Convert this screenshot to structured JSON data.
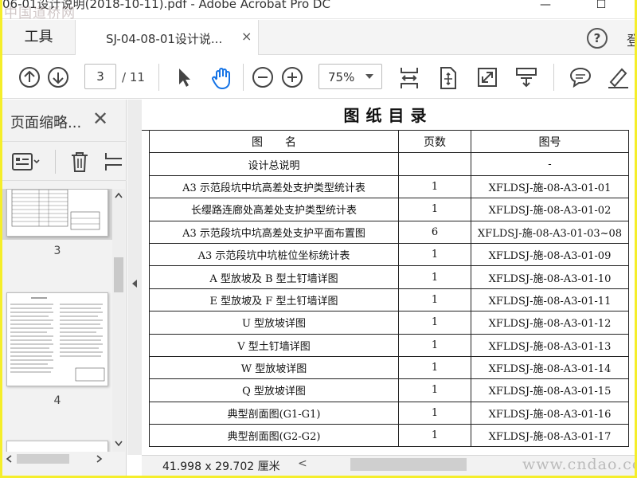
{
  "window": {
    "title": "06-01设计说明(2018-10-11).pdf - Adobe Acrobat Pro DC",
    "watermark_top": "中国道桥网",
    "minimize": "—",
    "maximize": "☐"
  },
  "tabs": {
    "tools": "工具",
    "document": "SJ-04-08-01设计说...",
    "close": "×",
    "help": "?",
    "login": "登"
  },
  "toolbar": {
    "current_page": "3",
    "total_pages": "/ 11",
    "zoom": "75%"
  },
  "left_pane": {
    "title": "页面缩略...",
    "close": "✕",
    "thumbnails": [
      {
        "label": "3",
        "selected": true
      },
      {
        "label": "4",
        "selected": false
      }
    ]
  },
  "document": {
    "title": "图纸目录",
    "columns": [
      "图　　名",
      "页数",
      "图号"
    ],
    "rows": [
      {
        "name": "设计总说明",
        "pages": "",
        "code": "-"
      },
      {
        "name": "A3 示范段坑中坑高差处支护类型统计表",
        "pages": "1",
        "code": "XFLDSJ-施-08-A3-01-01"
      },
      {
        "name": "长缨路连廊处高差处支护类型统计表",
        "pages": "1",
        "code": "XFLDSJ-施-08-A3-01-02"
      },
      {
        "name": "A3 示范段坑中坑高差处支护平面布置图",
        "pages": "6",
        "code": "XFLDSJ-施-08-A3-01-03~08"
      },
      {
        "name": "A3 示范段坑中坑桩位坐标统计表",
        "pages": "1",
        "code": "XFLDSJ-施-08-A3-01-09"
      },
      {
        "name": "A 型放坡及 B 型土钉墙详图",
        "pages": "1",
        "code": "XFLDSJ-施-08-A3-01-10"
      },
      {
        "name": "E 型放坡及 F 型土钉墙详图",
        "pages": "1",
        "code": "XFLDSJ-施-08-A3-01-11"
      },
      {
        "name": "U 型放坡详图",
        "pages": "1",
        "code": "XFLDSJ-施-08-A3-01-12"
      },
      {
        "name": "V 型土钉墙详图",
        "pages": "1",
        "code": "XFLDSJ-施-08-A3-01-13"
      },
      {
        "name": "W 型放坡详图",
        "pages": "1",
        "code": "XFLDSJ-施-08-A3-01-14"
      },
      {
        "name": "Q 型放坡详图",
        "pages": "1",
        "code": "XFLDSJ-施-08-A3-01-15"
      },
      {
        "name": "典型剖面图(G1-G1)",
        "pages": "1",
        "code": "XFLDSJ-施-08-A3-01-16"
      },
      {
        "name": "典型剖面图(G2-G2)",
        "pages": "1",
        "code": "XFLDSJ-施-08-A3-01-17"
      }
    ]
  },
  "status": {
    "page_size": "41.998 x 29.702 厘米",
    "watermark": "www.cndao.com"
  },
  "colors": {
    "frame": "#f5ee2a",
    "accent_blue": "#1473e6"
  },
  "icons": [
    "prev-page-icon",
    "next-page-icon",
    "select-arrow-icon",
    "hand-icon",
    "zoom-out-icon",
    "zoom-in-icon",
    "fit-width-icon",
    "fit-page-icon",
    "fullscreen-icon",
    "scroll-mode-icon",
    "comment-icon",
    "highlight-icon",
    "options-icon",
    "trash-icon",
    "insert-icon"
  ]
}
